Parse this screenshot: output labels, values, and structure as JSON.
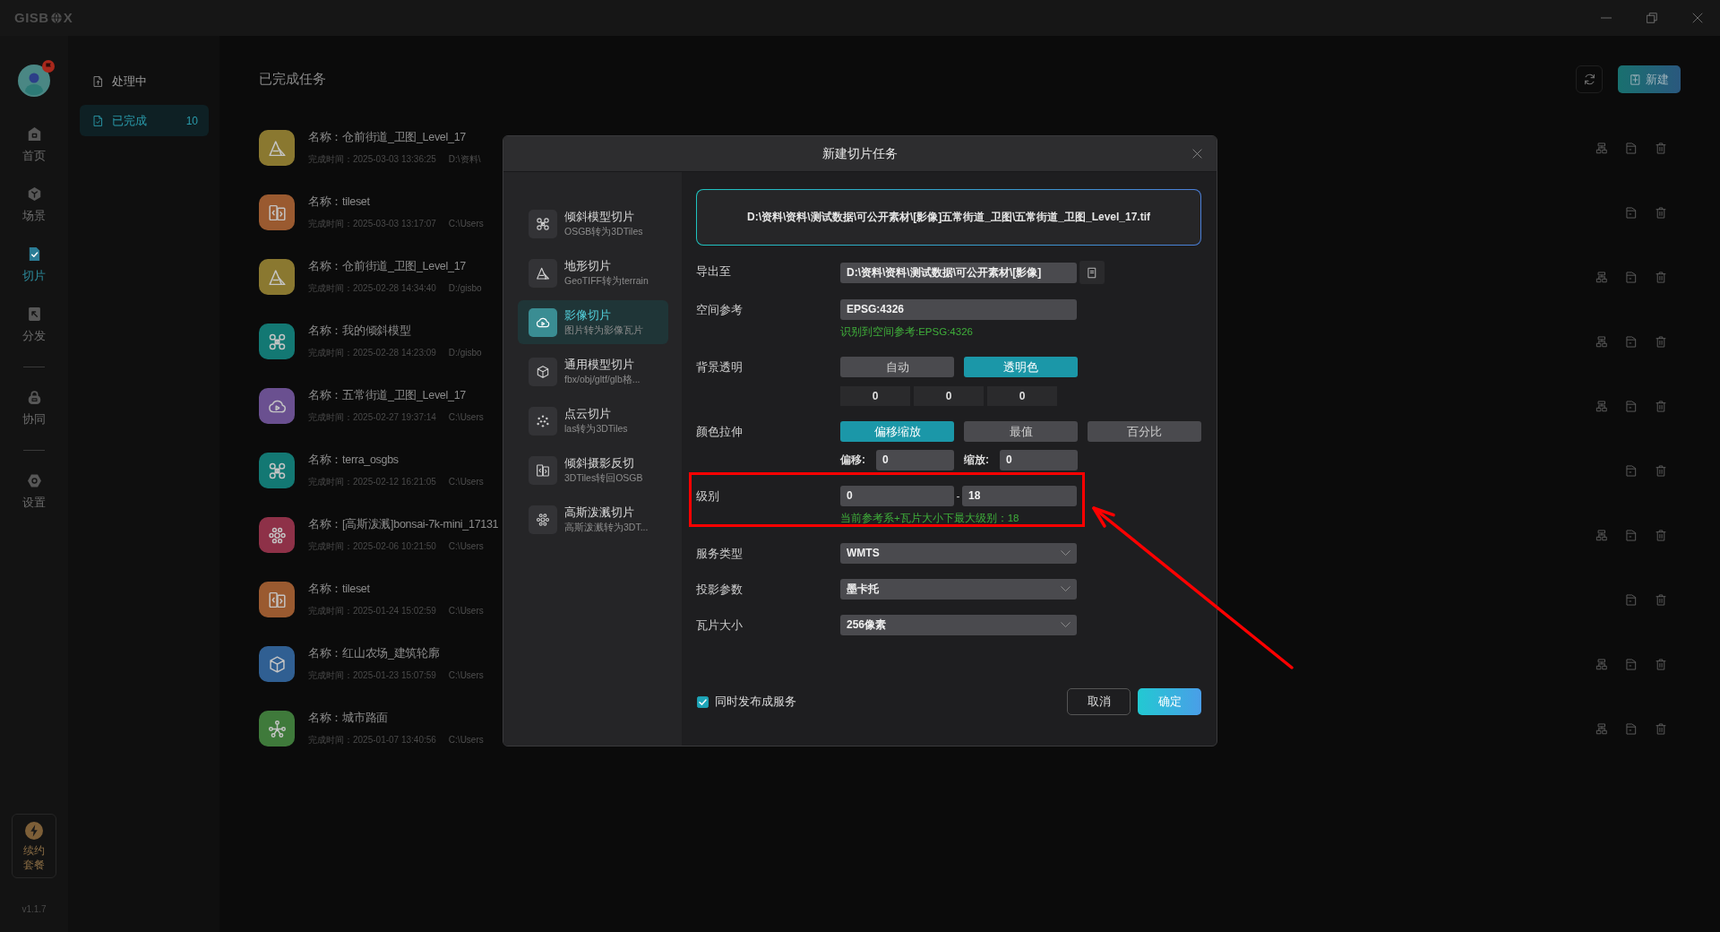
{
  "window": {
    "logo_left": "GISB",
    "logo_right": "X"
  },
  "nav": {
    "avatar": {
      "badge": true
    },
    "groups": [
      [
        {
          "kind": "home",
          "label": "首页",
          "selected": false
        },
        {
          "kind": "scene",
          "label": "场景",
          "selected": false
        },
        {
          "kind": "slice",
          "label": "切片",
          "selected": true
        },
        {
          "kind": "distribute",
          "label": "分发",
          "selected": false
        }
      ],
      [
        {
          "kind": "collab",
          "label": "协同",
          "selected": false
        }
      ],
      [
        {
          "kind": "settings",
          "label": "设置",
          "selected": false
        }
      ]
    ],
    "renew": "续约套餐",
    "version": "v1.1.7"
  },
  "sub_nav": [
    {
      "kind": "upload",
      "label": "处理中",
      "selected": false
    },
    {
      "kind": "done",
      "label": "已完成",
      "count": "10",
      "selected": true
    }
  ],
  "main": {
    "title": "已完成任务",
    "new_button": "新建"
  },
  "tasks": [
    {
      "kind": "mountain",
      "color": "#8a7830",
      "name": "名称：仓前街道_卫图_Level_17",
      "time": "完成时间：2025-03-03 13:36:25",
      "path": "D:\\资料\\",
      "actions": [
        {
          "kind": "hierarchy"
        },
        {
          "kind": "archive"
        },
        {
          "kind": "delete"
        }
      ]
    },
    {
      "kind": "split",
      "color": "#9a5a30",
      "name": "名称：tileset",
      "time": "完成时间：2025-03-03 13:17:07",
      "path": "C:\\Users",
      "actions": [
        {
          "kind": "archive"
        },
        {
          "kind": "delete"
        }
      ]
    },
    {
      "kind": "mountain",
      "color": "#8a7830",
      "name": "名称：仓前街道_卫图_Level_17",
      "time": "完成时间：2025-02-28 14:34:40",
      "path": "D:/gisbo",
      "actions": [
        {
          "kind": "hierarchy"
        },
        {
          "kind": "archive"
        },
        {
          "kind": "delete"
        }
      ]
    },
    {
      "kind": "drone",
      "color": "#137873",
      "name": "名称：我的倾斜模型",
      "time": "完成时间：2025-02-28 14:23:09",
      "path": "D:/gisbo",
      "actions": [
        {
          "kind": "hierarchy"
        },
        {
          "kind": "archive"
        },
        {
          "kind": "delete"
        }
      ]
    },
    {
      "kind": "cloud",
      "color": "#6a5090",
      "name": "名称：五常街道_卫图_Level_17",
      "time": "完成时间：2025-02-27 19:37:14",
      "path": "C:\\Users",
      "actions": [
        {
          "kind": "hierarchy"
        },
        {
          "kind": "archive"
        },
        {
          "kind": "delete"
        }
      ]
    },
    {
      "kind": "drone",
      "color": "#137873",
      "name": "名称：terra_osgbs",
      "time": "完成时间：2025-02-12 16:21:05",
      "path": "C:\\Users",
      "actions": [
        {
          "kind": "archive"
        },
        {
          "kind": "delete"
        }
      ]
    },
    {
      "kind": "nodes",
      "color": "#8e3148",
      "name": "名称：[高斯泼溅]bonsai-7k-mini_17131",
      "time": "完成时间：2025-02-06 10:21:50",
      "path": "C:\\Users",
      "actions": [
        {
          "kind": "hierarchy"
        },
        {
          "kind": "archive"
        },
        {
          "kind": "delete"
        }
      ]
    },
    {
      "kind": "split",
      "color": "#9a5a30",
      "name": "名称：tileset",
      "time": "完成时间：2025-01-24 15:02:59",
      "path": "C:\\Users",
      "actions": [
        {
          "kind": "archive"
        },
        {
          "kind": "delete"
        }
      ]
    },
    {
      "kind": "cube",
      "color": "#305f92",
      "name": "名称：红山农场_建筑轮廓",
      "time": "完成时间：2025-01-23 15:07:59",
      "path": "C:\\Users",
      "actions": [
        {
          "kind": "hierarchy"
        },
        {
          "kind": "archive"
        },
        {
          "kind": "delete"
        }
      ]
    },
    {
      "kind": "network",
      "color": "#3f7a3b",
      "name": "名称：城市路面",
      "time": "完成时间：2025-01-07 13:40:56",
      "path": "C:\\Users",
      "actions": [
        {
          "kind": "hierarchy"
        },
        {
          "kind": "archive"
        },
        {
          "kind": "delete"
        }
      ]
    }
  ],
  "dialog": {
    "title": "新建切片任务",
    "types": [
      {
        "kind": "drone",
        "title": "倾斜模型切片",
        "subtitle": "OSGB转为3DTiles",
        "selected": false
      },
      {
        "kind": "mountain",
        "title": "地形切片",
        "subtitle": "GeoTIFF转为terrain",
        "selected": false
      },
      {
        "kind": "cloud",
        "title": "影像切片",
        "subtitle": "图片转为影像瓦片",
        "selected": true
      },
      {
        "kind": "cube",
        "title": "通用模型切片",
        "subtitle": "fbx/obj/gltf/glb格...",
        "selected": false
      },
      {
        "kind": "dots",
        "title": "点云切片",
        "subtitle": "las转为3DTiles",
        "selected": false
      },
      {
        "kind": "split",
        "title": "倾斜摄影反切",
        "subtitle": "3DTiles转回OSGB",
        "selected": false
      },
      {
        "kind": "nodes",
        "title": "高斯泼溅切片",
        "subtitle": "高斯泼溅转为3DT...",
        "selected": false
      }
    ],
    "source": "D:\\资料\\资料\\测试数据\\可公开素材\\[影像]五常街道_卫图\\五常街道_卫图_Level_17.tif",
    "fields": [
      {
        "kind": "path",
        "label": "导出至",
        "value": "D:\\资料\\资料\\测试数据\\可公开素材\\[影像]"
      },
      {
        "kind": "text",
        "label": "空间参考",
        "value": "EPSG:4326",
        "hint": "识别到空间参考:EPSG:4326"
      },
      {
        "kind": "choice",
        "label": "背景透明",
        "options": [
          {
            "label": "自动",
            "selected": false
          },
          {
            "label": "透明色",
            "selected": true
          }
        ],
        "color_values": [
          "0",
          "0",
          "0"
        ]
      },
      {
        "kind": "choice",
        "label": "颜色拉伸",
        "options": [
          {
            "label": "偏移缩放",
            "selected": true
          },
          {
            "label": "最值",
            "selected": false
          },
          {
            "label": "百分比",
            "selected": false
          }
        ],
        "params": [
          {
            "label": "偏移:",
            "value": "0"
          },
          {
            "label": "缩放:",
            "value": "0"
          }
        ]
      },
      {
        "kind": "range",
        "label": "级别",
        "from": "0",
        "separator": "-",
        "to": "18",
        "hint": "当前参考系+瓦片大小下最大级别：18"
      },
      {
        "kind": "select",
        "label": "服务类型",
        "value": "WMTS"
      },
      {
        "kind": "select",
        "label": "投影参数",
        "value": "墨卡托"
      },
      {
        "kind": "select",
        "label": "瓦片大小",
        "value": "256像素"
      }
    ],
    "publish": {
      "label": "同时发布成服务",
      "checked": true
    },
    "buttons": [
      {
        "kind": "secondary",
        "label": "取消"
      },
      {
        "kind": "primary",
        "label": "确定"
      }
    ]
  },
  "markup": {
    "highlight_box": true,
    "arrow": true
  }
}
